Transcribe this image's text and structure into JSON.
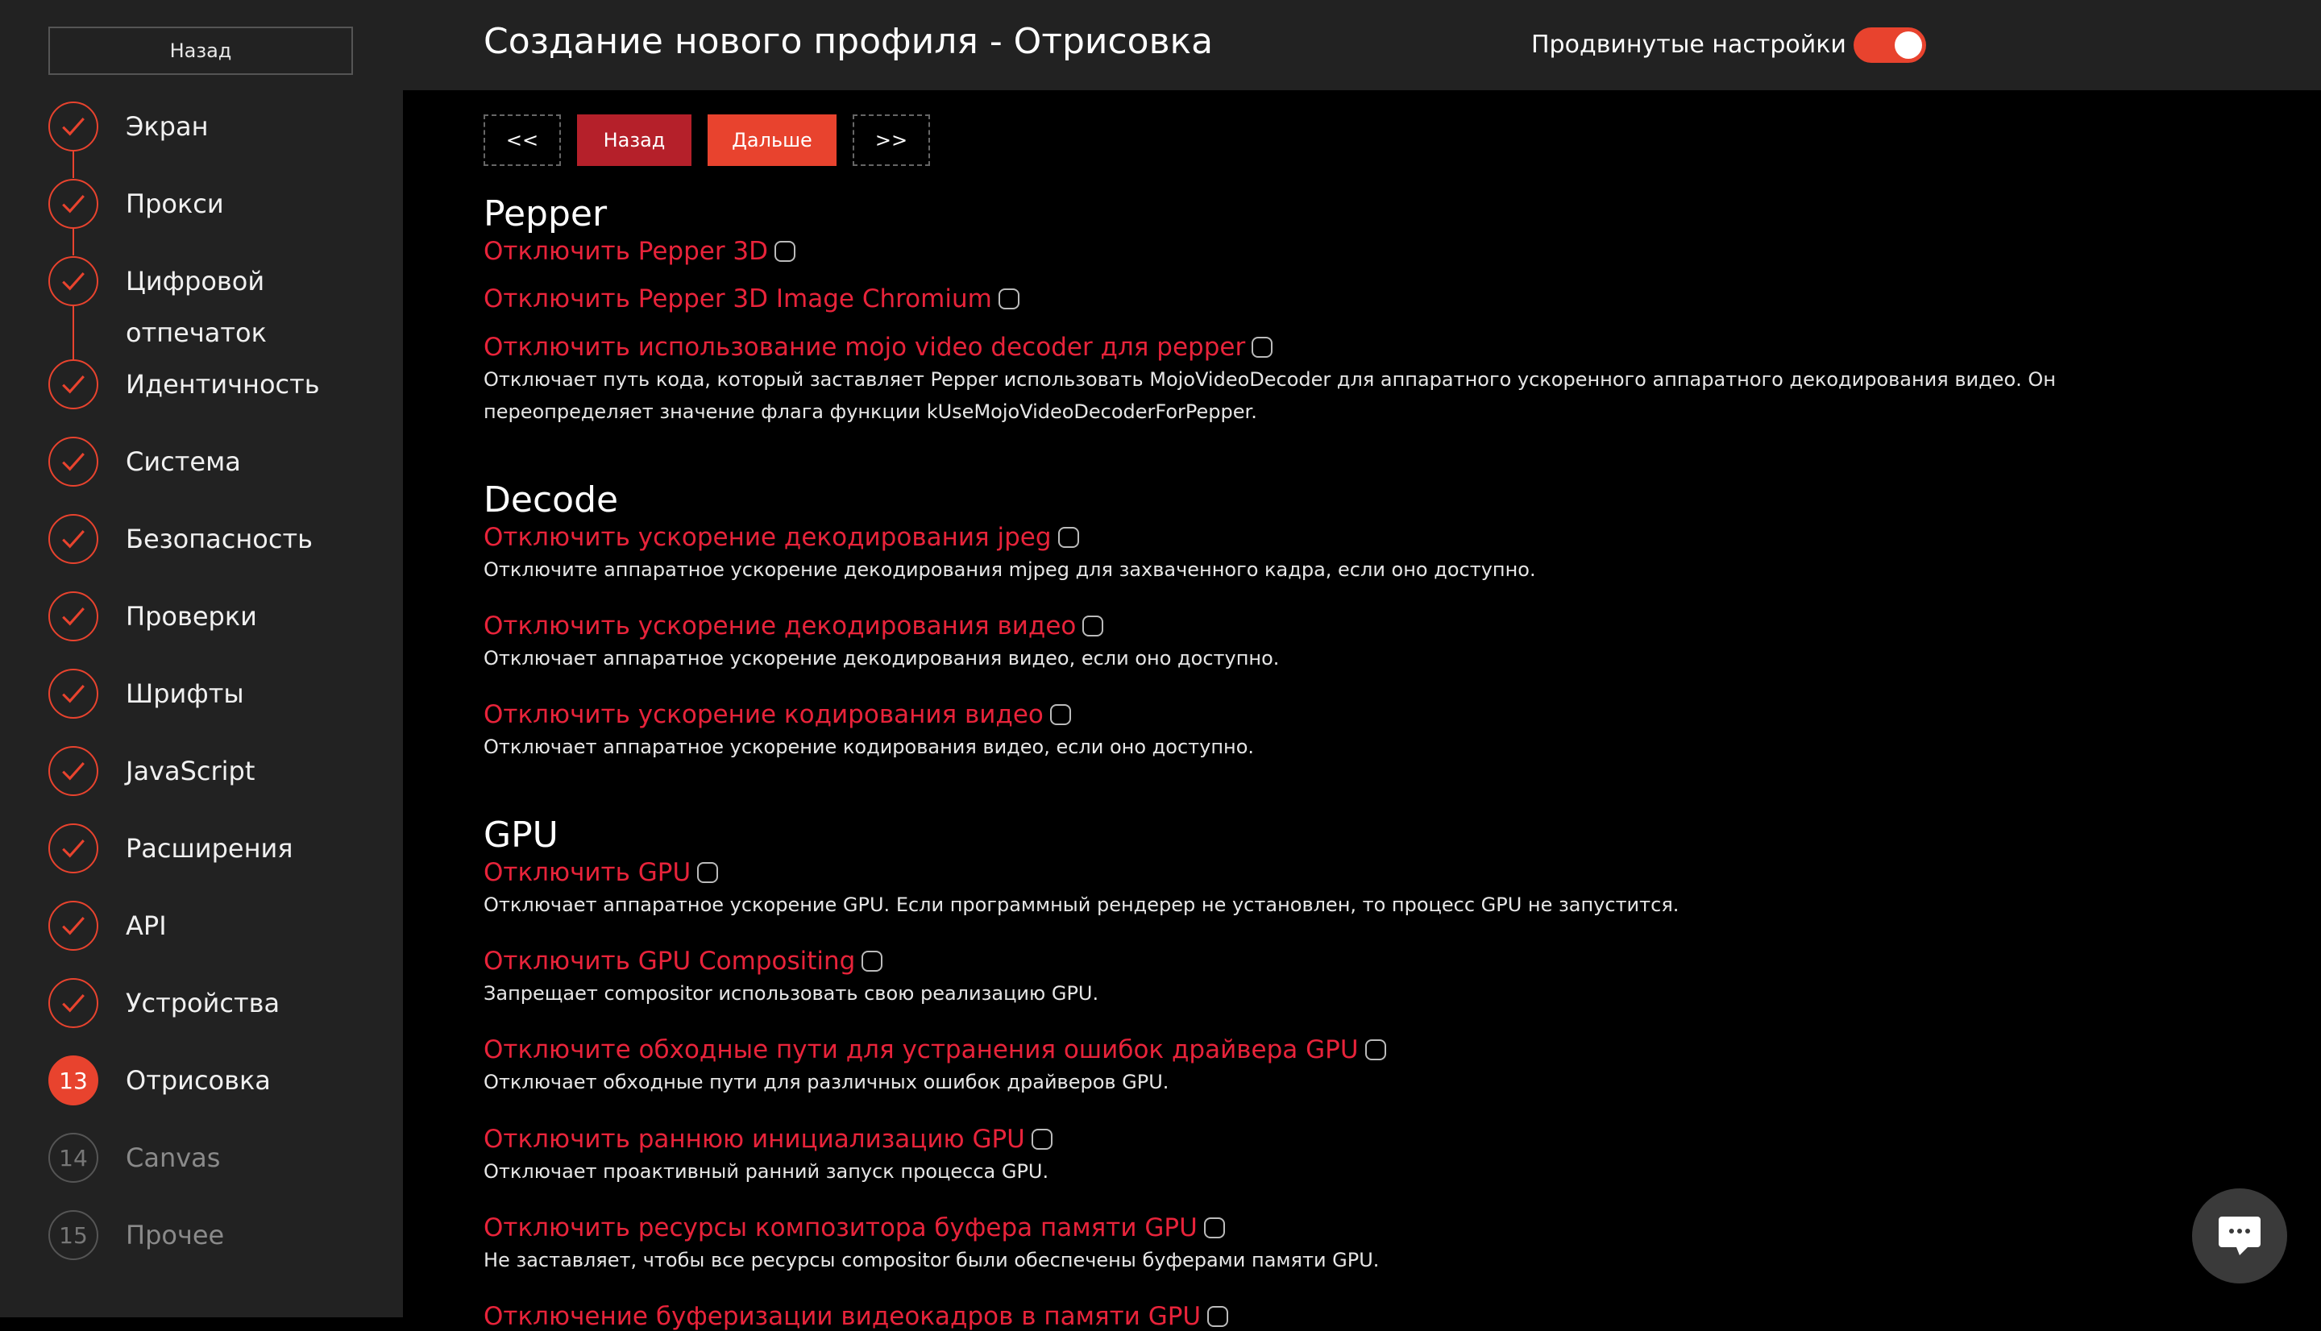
{
  "sidebar": {
    "back_label": "Назад",
    "steps": [
      {
        "label": "Экран",
        "state": "done"
      },
      {
        "label": "Прокси",
        "state": "done"
      },
      {
        "label": "Цифровой отпечаток",
        "state": "done"
      },
      {
        "label": "Идентичность",
        "state": "done"
      },
      {
        "label": "Система",
        "state": "done"
      },
      {
        "label": "Безопасность",
        "state": "done"
      },
      {
        "label": "Проверки",
        "state": "done"
      },
      {
        "label": "Шрифты",
        "state": "done"
      },
      {
        "label": "JavaScript",
        "state": "done"
      },
      {
        "label": "Расширения",
        "state": "done"
      },
      {
        "label": "API",
        "state": "done"
      },
      {
        "label": "Устройства",
        "state": "done"
      },
      {
        "label": "Отрисовка",
        "state": "active",
        "number": "13"
      },
      {
        "label": "Canvas",
        "state": "pending",
        "number": "14"
      },
      {
        "label": "Прочее",
        "state": "pending",
        "number": "15"
      }
    ]
  },
  "header": {
    "title": "Создание нового профиля - Отрисовка",
    "advanced_label": "Продвинутые настройки",
    "advanced_enabled": true
  },
  "nav": {
    "first": "<<",
    "back": "Назад",
    "next": "Дальше",
    "last": ">>"
  },
  "sections": {
    "pepper": {
      "title": "Pepper",
      "options": [
        {
          "title": "Отключить Pepper 3D",
          "checked": false,
          "desc": ""
        },
        {
          "title": "Отключить Pepper 3D Image Chromium",
          "checked": false,
          "desc": ""
        },
        {
          "title": "Отключить использование mojo video decoder для pepper",
          "checked": false,
          "desc": "Отключает путь кода, который заставляет Pepper использовать MojoVideoDecoder для аппаратного ускоренного аппаратного декодирования видео. Он переопределяет значение флага функции kUseMojoVideoDecoderForPepper."
        }
      ]
    },
    "decode": {
      "title": "Decode",
      "options": [
        {
          "title": "Отключить ускорение декодирования jpeg",
          "checked": false,
          "desc": "Отключите аппаратное ускорение декодирования mjpeg для захваченного кадра, если оно доступно."
        },
        {
          "title": "Отключить ускорение декодирования видео",
          "checked": false,
          "desc": "Отключает аппаратное ускорение декодирования видео, если оно доступно."
        },
        {
          "title": "Отключить ускорение кодирования видео",
          "checked": false,
          "desc": "Отключает аппаратное ускорение кодирования видео, если оно доступно."
        }
      ]
    },
    "gpu": {
      "title": "GPU",
      "options": [
        {
          "title": "Отключить GPU",
          "checked": false,
          "desc": "Отключает аппаратное ускорение GPU. Если программный рендерер не установлен, то процесс GPU не запустится."
        },
        {
          "title": "Отключить GPU Compositing",
          "checked": false,
          "desc": "Запрещает compositor использовать свою реализацию GPU."
        },
        {
          "title": "Отключите обходные пути для устранения ошибок драйвера GPU",
          "checked": false,
          "desc": "Отключает обходные пути для различных ошибок драйверов GPU."
        },
        {
          "title": "Отключить раннюю инициализацию GPU",
          "checked": false,
          "desc": "Отключает проактивный ранний запуск процесса GPU."
        },
        {
          "title": "Отключить ресурсы композитора буфера памяти GPU",
          "checked": false,
          "desc": "Не заставляет, чтобы все ресурсы compositor были обеспечены буферами памяти GPU."
        },
        {
          "title": "Отключение буферизации видеокадров в памяти GPU",
          "checked": false,
          "desc": ""
        }
      ]
    }
  },
  "colors": {
    "accent": "#e8432e",
    "option_title": "#e8233a",
    "sidebar_bg": "#222222",
    "bg": "#000000"
  },
  "icons": {
    "done": "check-icon",
    "chat": "chat-icon"
  }
}
